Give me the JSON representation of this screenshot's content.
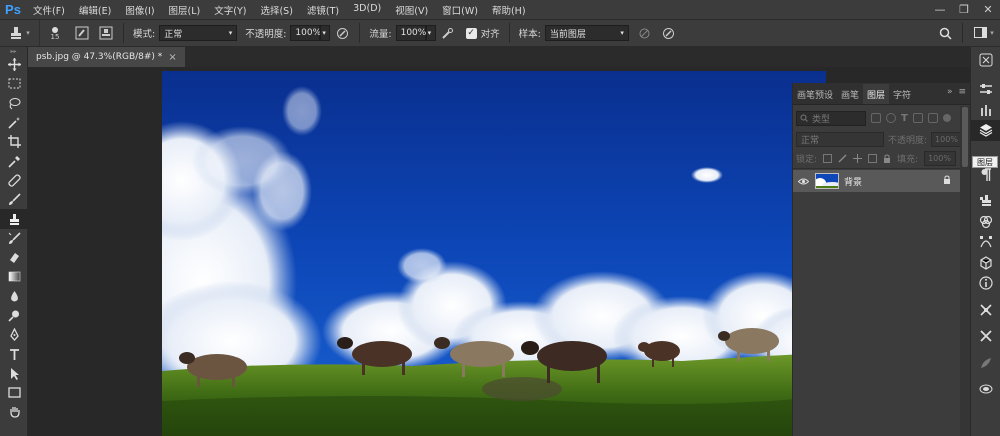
{
  "app": {
    "logo": "Ps"
  },
  "menu": [
    "文件(F)",
    "编辑(E)",
    "图像(I)",
    "图层(L)",
    "文字(Y)",
    "选择(S)",
    "滤镜(T)",
    "3D(D)",
    "视图(V)",
    "窗口(W)",
    "帮助(H)"
  ],
  "window_controls": {
    "minimize": "—",
    "restore": "❐",
    "close": "✕"
  },
  "options": {
    "brush_size": "15",
    "mode_label": "模式:",
    "mode_value": "正常",
    "opacity_label": "不透明度:",
    "opacity_value": "100%",
    "flow_label": "流量:",
    "flow_value": "100%",
    "aligned_label": "对齐",
    "aligned_checked": true,
    "sample_label": "样本:",
    "sample_value": "当前图层"
  },
  "document_tab": {
    "title": "psb.jpg @ 47.3%(RGB/8#) *",
    "close": "×"
  },
  "panel": {
    "tabs": [
      "画笔预设",
      "画笔",
      "图层",
      "字符"
    ],
    "active_tab": "图层",
    "collapse": "»",
    "menu": "≡",
    "filter_placeholder": "类型",
    "blend_mode": "正常",
    "opacity_label": "不透明度:",
    "opacity_value": "100%",
    "lock_label": "锁定:",
    "fill_label": "填充:",
    "fill_value": "100%",
    "layer_name": "背景"
  },
  "dock_tooltip": "图层",
  "colors": {
    "accent": "#3fa1ff",
    "panel_bg": "#3c3c3c",
    "canvas_bg": "#282828",
    "sky": "#0d3fa8"
  }
}
